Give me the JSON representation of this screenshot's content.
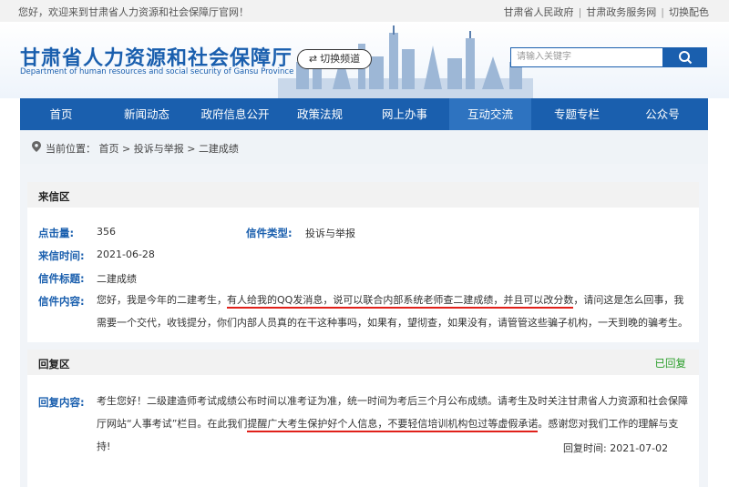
{
  "topbar": {
    "welcome": "您好，欢迎来到甘肃省人力资源和社会保障厅官网！",
    "links": [
      "甘肃省人民政府",
      "甘肃政务服务网",
      "切换配色"
    ]
  },
  "header": {
    "title": "甘肃省人力资源和社会保障厅",
    "subtitle": "Department of human resources and social security of Gansu Province",
    "switch_label": "切换频道",
    "search_placeholder": "请输入关键字"
  },
  "nav": [
    "首页",
    "新闻动态",
    "政府信息公开",
    "政策法规",
    "网上办事",
    "互动交流",
    "专题专栏",
    "公众号"
  ],
  "nav_active": "互动交流",
  "breadcrumb": {
    "label": "当前位置：",
    "items": [
      "首页",
      "投诉与举报",
      "二建成绩"
    ]
  },
  "letter": {
    "section_title": "来信区",
    "clicks_label": "点击量:",
    "clicks": "356",
    "type_label": "信件类型:",
    "type": "投诉与举报",
    "time_label": "来信时间:",
    "time": "2021-06-28",
    "subject_label": "信件标题:",
    "subject": "二建成绩",
    "content_label": "信件内容:",
    "content_pre": "您好，我是今年的二建考生，",
    "content_underlined": "有人给我的QQ发消息，说可以联合内部系统老师查二建成绩，并且可以改分数",
    "content_post": "，请问这是怎么回事，我需要一个交代，收钱提分，你们内部人员真的在干这种事吗，如果有，望彻查，如果没有，请管管这些骗子机构，一天到晚的骗考生。"
  },
  "reply": {
    "section_title": "回复区",
    "status": "已回复",
    "content_label": "回复内容:",
    "content_pre": "考生您好！二级建造师考试成绩公布时间以准考证为准，统一时间为考后三个月公布成绩。请考生及时关注甘肃省人力资源和社会保障厅网站“人事考试”栏目。在此我们",
    "content_underlined": "提醒广大考生保护好个人信息，不要轻信培训机构包过等虚假承诺",
    "content_post": "。感谢您对我们工作的理解与支持!",
    "time_label": "回复时间:",
    "time": "2021-07-02"
  }
}
